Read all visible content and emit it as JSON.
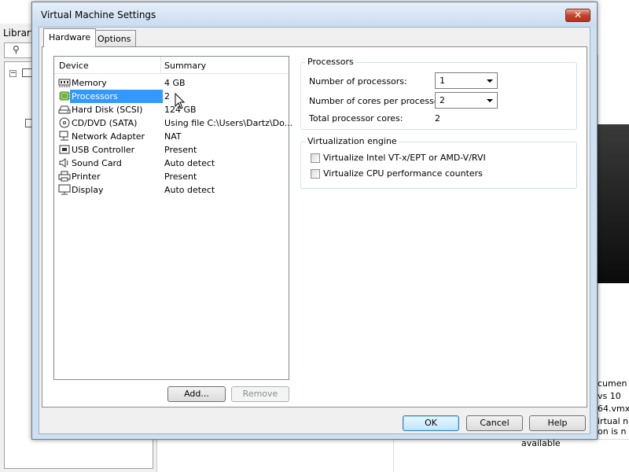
{
  "background": {
    "library_label": "Library",
    "right_text": [
      "cumen",
      "vs 10",
      "64.vmx",
      "irtual n",
      "on is n",
      "available"
    ]
  },
  "dialog": {
    "title": "Virtual Machine Settings",
    "close_label": "✕",
    "tabs": [
      {
        "label": "Hardware",
        "active": true
      },
      {
        "label": "Options",
        "active": false
      }
    ],
    "device_list": {
      "columns": [
        "Device",
        "Summary"
      ],
      "rows": [
        {
          "icon": "memory-icon",
          "name": "Memory",
          "summary": "4 GB",
          "selected": false
        },
        {
          "icon": "processor-icon",
          "name": "Processors",
          "summary": "2",
          "selected": true
        },
        {
          "icon": "hard-disk-icon",
          "name": "Hard Disk (SCSI)",
          "summary": "124 GB",
          "selected": false
        },
        {
          "icon": "cd-dvd-icon",
          "name": "CD/DVD (SATA)",
          "summary": "Using file C:\\Users\\Dartz\\Do...",
          "selected": false
        },
        {
          "icon": "network-adapter-icon",
          "name": "Network Adapter",
          "summary": "NAT",
          "selected": false
        },
        {
          "icon": "usb-controller-icon",
          "name": "USB Controller",
          "summary": "Present",
          "selected": false
        },
        {
          "icon": "sound-card-icon",
          "name": "Sound Card",
          "summary": "Auto detect",
          "selected": false
        },
        {
          "icon": "printer-icon",
          "name": "Printer",
          "summary": "Present",
          "selected": false
        },
        {
          "icon": "display-icon",
          "name": "Display",
          "summary": "Auto detect",
          "selected": false
        }
      ]
    },
    "add_label": "Add...",
    "remove_label": "Remove",
    "processors_group": {
      "title": "Processors",
      "num_processors_label": "Number of processors:",
      "num_processors_value": "1",
      "cores_label": "Number of cores per processor:",
      "cores_value": "2",
      "total_label": "Total processor cores:",
      "total_value": "2"
    },
    "virtualization_group": {
      "title": "Virtualization engine",
      "option1": {
        "label": "Virtualize Intel VT-x/EPT or AMD-V/RVI",
        "checked": false
      },
      "option2": {
        "label": "Virtualize CPU performance counters",
        "checked": false
      }
    },
    "ok_label": "OK",
    "cancel_label": "Cancel",
    "help_label": "Help"
  },
  "colors": {
    "selection": "#3399ff",
    "title_bar": "#c9dcf0",
    "close_button": "#c3432b"
  }
}
